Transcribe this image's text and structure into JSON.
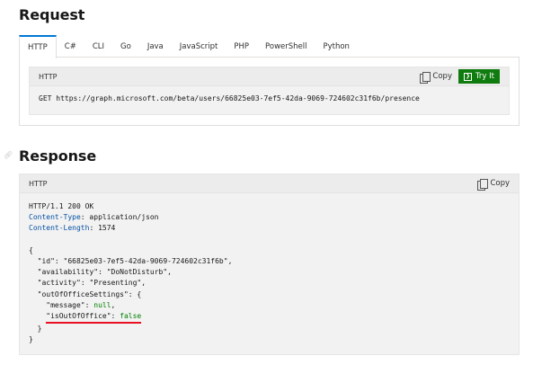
{
  "request": {
    "title": "Request",
    "tabs": [
      "HTTP",
      "C#",
      "CLI",
      "Go",
      "Java",
      "JavaScript",
      "PHP",
      "PowerShell",
      "Python"
    ],
    "active_tab": "HTTP",
    "code_lang": "HTTP",
    "copy_label": "Copy",
    "try_label": "Try It",
    "code": "GET https://graph.microsoft.com/beta/users/66825e03-7ef5-42da-9069-724602c31f6b/presence"
  },
  "response": {
    "title": "Response",
    "code_lang": "HTTP",
    "copy_label": "Copy",
    "status_line": "HTTP/1.1 200 OK",
    "header1_key": "Content-Type",
    "header1_val": ": application/json",
    "header2_key": "Content-Length",
    "header2_val": ": 1574",
    "json": {
      "open": "{",
      "id_key": "\"id\"",
      "id_val": ": \"66825e03-7ef5-42da-9069-724602c31f6b\",",
      "availability_key": "\"availability\"",
      "availability_val": ": \"DoNotDisturb\",",
      "activity_key": "\"activity\"",
      "activity_val": ": \"Presenting\",",
      "oof_key": "\"outOfOfficeSettings\"",
      "oof_val": ": {",
      "message_key": "\"message\"",
      "message_sep": ": ",
      "message_val": "null",
      "message_comma": ",",
      "isoof_key": "\"isOutOfOffice\"",
      "isoof_sep": ": ",
      "isoof_val": "false",
      "inner_close": "}",
      "close": "}"
    }
  },
  "colors": {
    "accent": "#0078d4",
    "try_it_bg": "#107c10",
    "highlight_underline": "#e81123",
    "json_key": "#0451a5",
    "json_literal": "#008000"
  }
}
